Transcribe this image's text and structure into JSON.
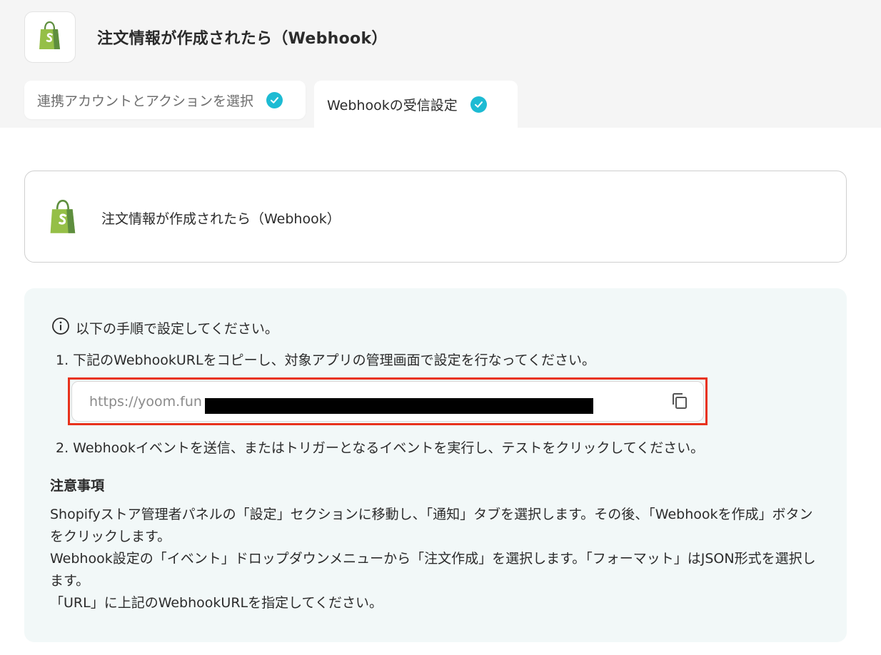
{
  "header": {
    "app_icon": "shopify-bag-icon",
    "title": "注文情報が作成されたら（Webhook）"
  },
  "tabs": [
    {
      "label": "連携アカウントとアクションを選択",
      "status": "complete",
      "active": false
    },
    {
      "label": "Webhookの受信設定",
      "status": "complete",
      "active": true
    }
  ],
  "trigger_card": {
    "icon": "shopify-bag-icon",
    "label": "注文情報が作成されたら（Webhook）"
  },
  "instructions": {
    "heading": "以下の手順で設定してください。",
    "step1": "1. 下記のWebhookURLをコピーし、対象アプリの管理画面で設定を行なってください。",
    "webhook_url_visible": "https://yoom.fun",
    "step2": "2. Webhookイベントを送信、またはトリガーとなるイベントを実行し、テストをクリックしてください。"
  },
  "notes": {
    "title": "注意事項",
    "line1": "Shopifyストア管理者パネルの「設定」セクションに移動し、「通知」タブを選択します。その後、「Webhookを作成」ボタンをクリックします。",
    "line2": "Webhook設定の「イベント」ドロップダウンメニューから「注文作成」を選択します。「フォーマット」はJSON形式を選択します。",
    "line3": "「URL」に上記のWebhookURLを指定してください。"
  },
  "colors": {
    "accent_check": "#1dbbd3",
    "highlight_border": "#e8321c",
    "panel_bg": "#f2f8f8",
    "shopify_green": "#95bf47"
  }
}
